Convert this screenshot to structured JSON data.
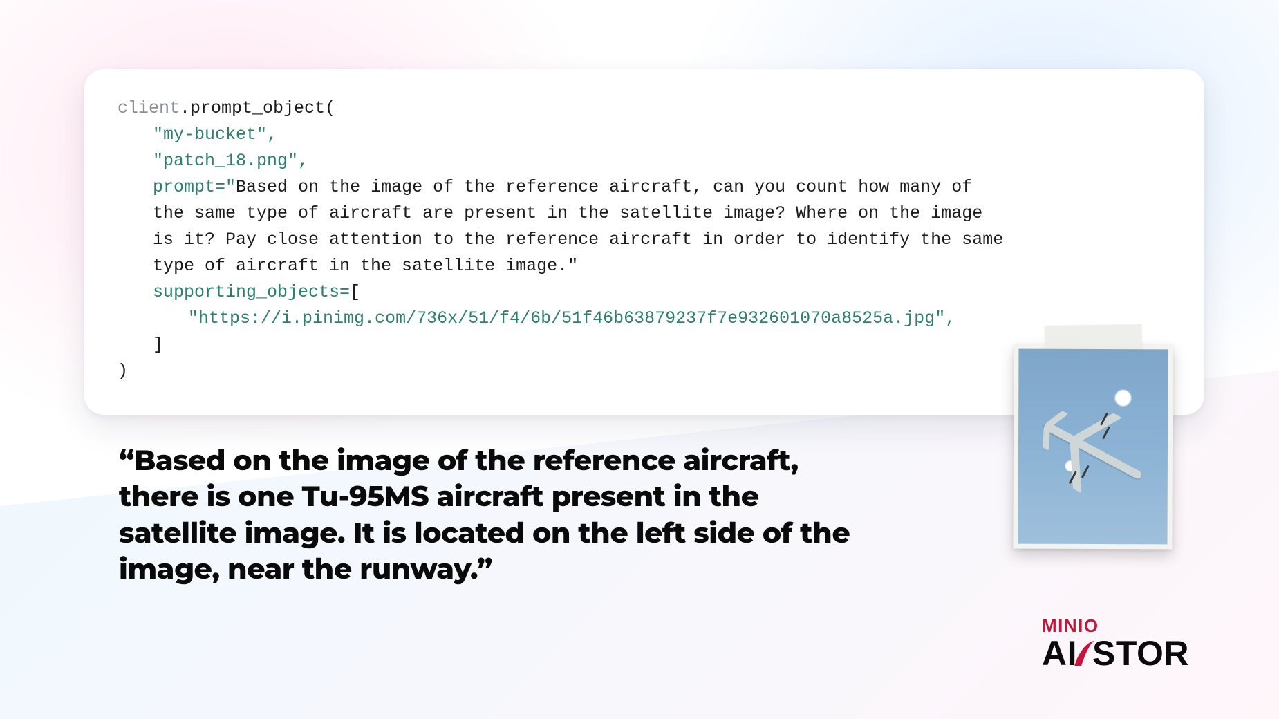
{
  "code": {
    "client_var": "client",
    "method": ".prompt_object(",
    "arg_bucket": "\"my-bucket\",",
    "arg_file": "\"patch_18.png\",",
    "prompt_kw": "prompt=",
    "prompt_open": "\"",
    "prompt_text_l1": "Based on the image of the reference aircraft, can you count how many of",
    "prompt_text_l2": "the same type of aircraft are present in the satellite image? Where on the image",
    "prompt_text_l3": "is it? Pay close attention to the reference aircraft in order to identify the same",
    "prompt_text_l4": "type of aircraft in the satellite image.\"",
    "supporting_kw": "supporting_objects=",
    "supporting_open": "[",
    "supporting_url": "\"https://i.pinimg.com/736x/51/f4/6b/51f46b63879237f7e932601070a8525a.jpg\",",
    "supporting_close": "]",
    "call_close": ")"
  },
  "result_quote": "“Based on the image of the reference aircraft, there is one Tu-95MS aircraft present in the satellite image. It is located on the left side of the image, near the runway.”",
  "logo": {
    "top": "MINIO",
    "bottom_left": "AI",
    "bottom_right": "STOR"
  },
  "reference_image_alt": "reference aircraft Tu-95MS photo"
}
